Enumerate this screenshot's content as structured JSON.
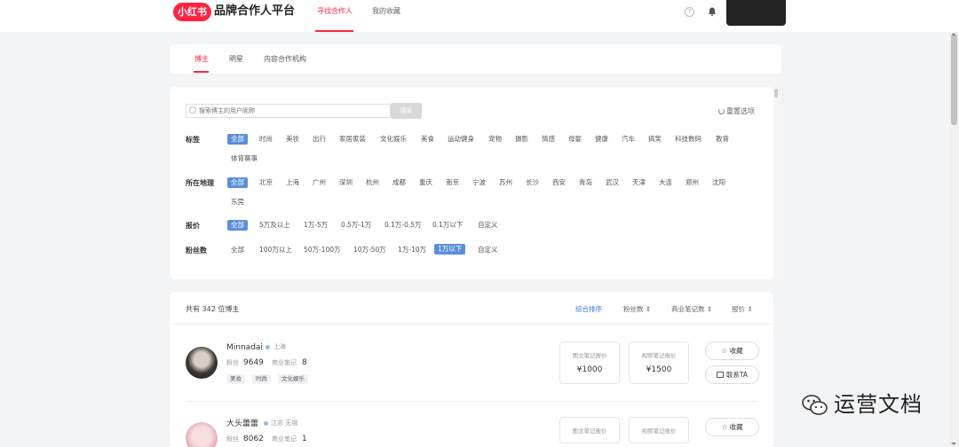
{
  "header": {
    "logo_text": "小红书",
    "brand": "品牌合作人平台",
    "tabs": [
      {
        "label": "寻找合作人",
        "active": true
      },
      {
        "label": "我的收藏",
        "active": false
      }
    ],
    "help_icon": "?"
  },
  "category_tabs": [
    {
      "label": "博主",
      "active": true
    },
    {
      "label": "明星",
      "active": false
    },
    {
      "label": "内容合作机构",
      "active": false
    }
  ],
  "search": {
    "placeholder": "搜索博主的用户昵称",
    "button_label": "搜索",
    "reset_label": "重置选项"
  },
  "filters": {
    "tags": {
      "label": "标签",
      "options": [
        "全部",
        "时尚",
        "美妆",
        "出行",
        "家居家装",
        "文化娱乐",
        "美食",
        "运动健身",
        "宠物",
        "摄影",
        "情感",
        "母婴",
        "健康",
        "汽车",
        "搞笑",
        "科技数码",
        "教育",
        "体育赛事"
      ],
      "selected": "全部"
    },
    "region": {
      "label": "所在地理",
      "options": [
        "全部",
        "北京",
        "上海",
        "广州",
        "深圳",
        "杭州",
        "成都",
        "重庆",
        "南京",
        "宁波",
        "苏州",
        "长沙",
        "西安",
        "青岛",
        "武汉",
        "天津",
        "大连",
        "郑州",
        "沈阳",
        "东莞"
      ],
      "selected": "全部"
    },
    "price": {
      "label": "报价",
      "options": [
        "全部",
        "5万及以上",
        "1万-5万",
        "0.5万-1万",
        "0.1万-0.5万",
        "0.1万以下",
        "自定义"
      ],
      "selected": "全部"
    },
    "fans": {
      "label": "粉丝数",
      "options": [
        "全部",
        "100万以上",
        "50万-100万",
        "10万-50万",
        "1万-10万",
        "1万以下",
        "自定义"
      ],
      "selected": "1万以下"
    }
  },
  "results": {
    "count_text": "共有 342 位博主",
    "sort_options": [
      {
        "label": "综合排序",
        "active": true
      },
      {
        "label": "粉丝数 ⇕",
        "active": false
      },
      {
        "label": "商业笔记数 ⇕",
        "active": false
      },
      {
        "label": "报价 ⇕",
        "active": false
      }
    ],
    "bloggers": [
      {
        "name": "Minnadai",
        "location": "上海",
        "fans_label": "粉丝",
        "fans": "9649",
        "notes_label": "商业笔记",
        "notes": "8",
        "tags": [
          "美妆",
          "时尚",
          "文化娱乐"
        ],
        "image_note_label": "图文笔记报价",
        "image_note_price": "¥1000",
        "video_note_label": "视频笔记报价",
        "video_note_price": "¥1500",
        "favorite_label": "收藏",
        "contact_label": "联系TA"
      },
      {
        "name": "大头蕾蕾",
        "location": "江苏 无锡",
        "fans_label": "粉丝",
        "fans": "8062",
        "notes_label": "商业笔记",
        "notes": "1",
        "image_note_label": "图文笔记报价",
        "video_note_label": "视频笔记报价",
        "favorite_label": "收藏"
      }
    ]
  },
  "watermark": {
    "text": "运营文档"
  },
  "colors": {
    "brand_red": "#ff2442",
    "selected_blue": "#5b8fd9",
    "link_blue": "#3b77d6"
  }
}
